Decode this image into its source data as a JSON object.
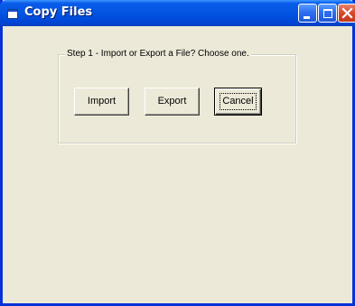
{
  "window": {
    "title": "Copy Files"
  },
  "step": {
    "label": "Step 1 - Import or Export a File? Choose one."
  },
  "buttons": {
    "import": "Import",
    "export": "Export",
    "cancel": "Cancel"
  },
  "colors": {
    "titlebar": "#0254e2",
    "face": "#ece9d8",
    "close": "#d8472a"
  }
}
